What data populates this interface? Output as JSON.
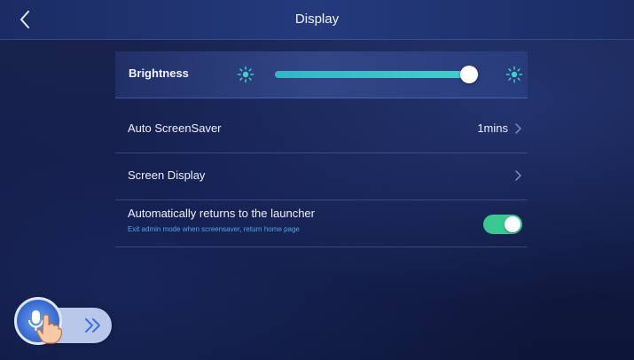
{
  "header": {
    "title": "Display"
  },
  "brightness": {
    "label": "Brightness",
    "level": 0.95
  },
  "settings": {
    "auto_screensaver": {
      "label": "Auto ScreenSaver",
      "value": "1mins"
    },
    "screen_display": {
      "label": "Screen Display"
    },
    "auto_return": {
      "label": "Automatically returns to the launcher",
      "sublabel": "Exit admin mode when screensaver, return home page",
      "enabled": true
    }
  },
  "colors": {
    "accent_teal": "#3fd0c9",
    "toggle_on": "#37c98f",
    "sublabel_blue": "#4fa6e8",
    "background": "#121b44"
  },
  "icons": [
    "back-arrow-icon",
    "sun-icon",
    "chevron-right-icon",
    "microphone-icon",
    "hand-pointer-icon",
    "double-chevron-right-icon"
  ]
}
